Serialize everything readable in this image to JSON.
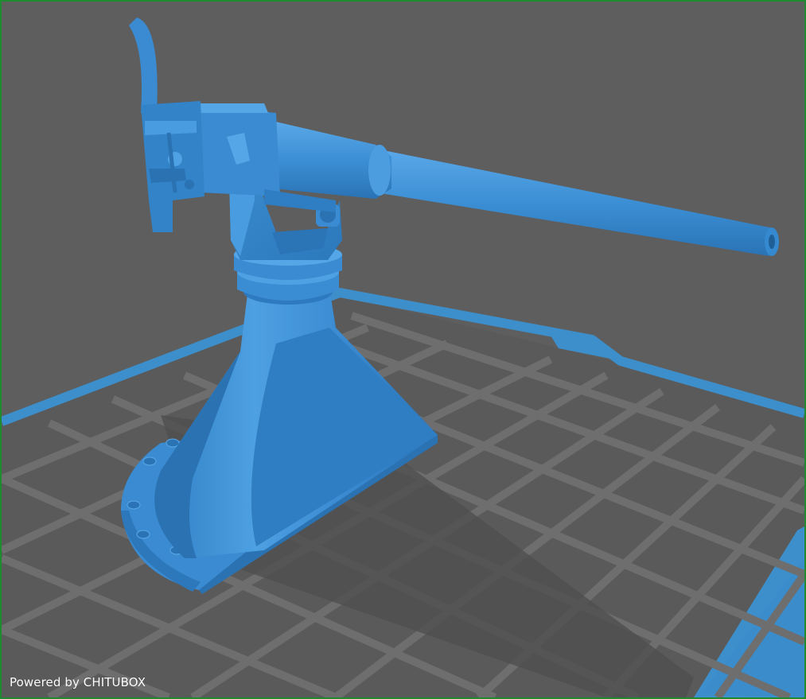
{
  "app": {
    "name": "CHITUBOX",
    "watermark_text": "Powered by CHITUBOX"
  },
  "viewport": {
    "background_color": "#5e5e5e",
    "border_color": "#1f8a2f",
    "build_plate": {
      "grid_line_color": "#6f6f6f",
      "plate_color": "#595959",
      "edge_color": "#3d8fcb"
    }
  },
  "model": {
    "description_icon": "deck-gun-model",
    "color": "#3d8fd6",
    "shade_color": "#2b76b6",
    "highlight_color": "#5aa8e8"
  }
}
